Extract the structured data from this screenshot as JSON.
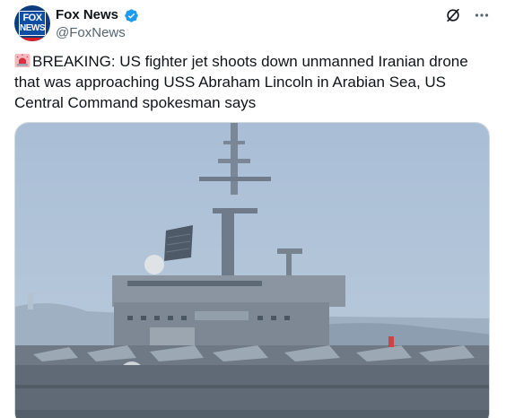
{
  "tweet": {
    "display_name": "Fox News",
    "handle": "@FoxNews",
    "avatar_text_top": "FOX",
    "avatar_text_bottom": "NEWS",
    "text": "BREAKING: US fighter jet shoots down unmanned Iranian drone that was approaching USS Abraham Lincoln in Arabian Sea, US Central Command spokesman says",
    "emoji_icon": "police-car-light-icon",
    "verified_icon": "verified-badge-icon",
    "grok_icon": "grok-icon",
    "more_icon": "more-options-icon",
    "media_description_icon": "aircraft-carrier-photo"
  },
  "colors": {
    "verified_blue": "#1d9bf0",
    "handle_gray": "#536471",
    "text_black": "#0f1419",
    "fox_blue": "#0b3c7d",
    "fox_red": "#d72027"
  }
}
